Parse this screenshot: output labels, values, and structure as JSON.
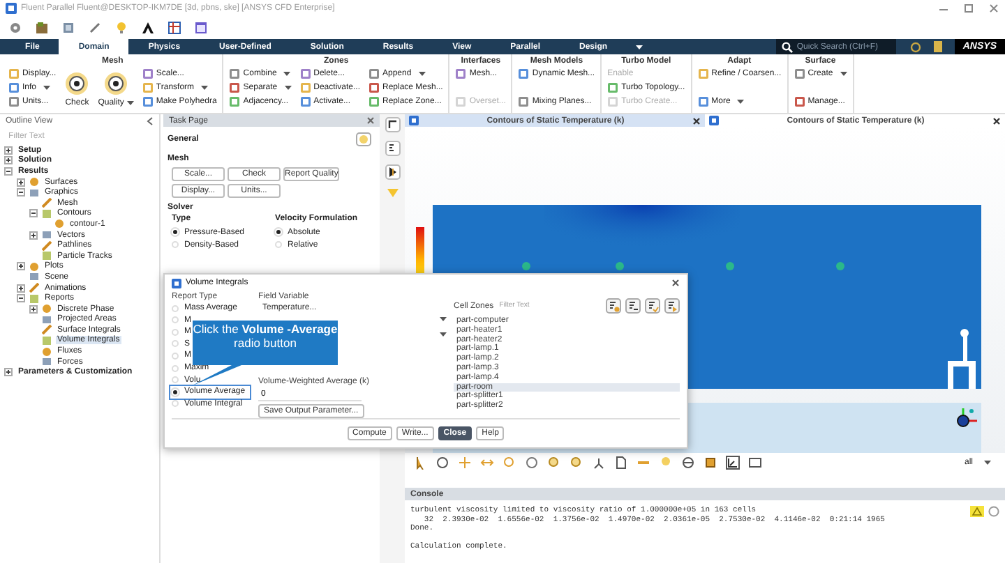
{
  "window": {
    "title": "Fluent Parallel Fluent@DESKTOP-IKM7DE [3d, pbns, ske] [ANSYS CFD Enterprise]"
  },
  "ribbon_tabs": [
    {
      "label": "File",
      "selected": false
    },
    {
      "label": "Domain",
      "selected": true
    },
    {
      "label": "Physics",
      "selected": false
    },
    {
      "label": "User-Defined",
      "selected": false
    },
    {
      "label": "Solution",
      "selected": false
    },
    {
      "label": "Results",
      "selected": false
    },
    {
      "label": "View",
      "selected": false
    },
    {
      "label": "Parallel",
      "selected": false
    },
    {
      "label": "Design",
      "selected": false
    }
  ],
  "search": {
    "placeholder": "Quick Search (Ctrl+F)"
  },
  "logo": "ANSYS",
  "ribbon_groups": [
    {
      "title": "Mesh",
      "columns": [
        [
          {
            "label": "Display...",
            "kind": "small",
            "dropdown": false,
            "disabled": false
          },
          {
            "label": "Info",
            "kind": "small",
            "dropdown": true,
            "disabled": false
          },
          {
            "label": "Units...",
            "kind": "small",
            "dropdown": false,
            "disabled": false
          }
        ],
        [
          {
            "label": "Check",
            "kind": "large",
            "dropdown": false,
            "disabled": false
          }
        ],
        [
          {
            "label": "Quality",
            "kind": "large",
            "dropdown": true,
            "disabled": false
          }
        ],
        [
          {
            "label": "Scale...",
            "kind": "small",
            "dropdown": false,
            "disabled": false
          },
          {
            "label": "Transform",
            "kind": "small",
            "dropdown": true,
            "disabled": false
          },
          {
            "label": "Make Polyhedra",
            "kind": "small",
            "dropdown": false,
            "disabled": false
          }
        ]
      ]
    },
    {
      "title": "Zones",
      "columns": [
        [
          {
            "label": "Combine",
            "kind": "small",
            "dropdown": true,
            "disabled": false
          },
          {
            "label": "Separate",
            "kind": "small",
            "dropdown": true,
            "disabled": false
          },
          {
            "label": "Adjacency...",
            "kind": "small",
            "dropdown": false,
            "disabled": false
          }
        ],
        [
          {
            "label": "Delete...",
            "kind": "small",
            "dropdown": false,
            "disabled": false
          },
          {
            "label": "Deactivate...",
            "kind": "small",
            "dropdown": false,
            "disabled": false
          },
          {
            "label": "Activate...",
            "kind": "small",
            "dropdown": false,
            "disabled": false
          }
        ],
        [
          {
            "label": "Append",
            "kind": "small",
            "dropdown": true,
            "disabled": false
          },
          {
            "label": "Replace Mesh...",
            "kind": "small",
            "dropdown": false,
            "disabled": false
          },
          {
            "label": "Replace Zone...",
            "kind": "small",
            "dropdown": false,
            "disabled": false
          }
        ]
      ]
    },
    {
      "title": "Interfaces",
      "columns": [
        [
          {
            "label": "Mesh...",
            "kind": "small",
            "dropdown": false,
            "disabled": false
          },
          {
            "label": "Overset...",
            "kind": "small",
            "dropdown": false,
            "disabled": true
          }
        ]
      ]
    },
    {
      "title": "Mesh Models",
      "columns": [
        [
          {
            "label": "Dynamic Mesh...",
            "kind": "small",
            "dropdown": false,
            "disabled": false
          },
          {
            "label": "Mixing Planes...",
            "kind": "small",
            "dropdown": false,
            "disabled": false
          }
        ]
      ]
    },
    {
      "title": "Turbo Model",
      "columns": [
        [
          {
            "label": "Enable",
            "kind": "plain",
            "dropdown": false,
            "disabled": true
          },
          {
            "label": "Turbo Topology...",
            "kind": "small",
            "dropdown": false,
            "disabled": false
          },
          {
            "label": "Turbo Create...",
            "kind": "small",
            "dropdown": false,
            "disabled": true
          }
        ]
      ]
    },
    {
      "title": "Adapt",
      "columns": [
        [
          {
            "label": "Refine / Coarsen...",
            "kind": "small",
            "dropdown": false,
            "disabled": false
          },
          {
            "label": "More",
            "kind": "small",
            "dropdown": true,
            "disabled": false
          }
        ]
      ]
    },
    {
      "title": "Surface",
      "columns": [
        [
          {
            "label": "Create",
            "kind": "small",
            "dropdown": true,
            "disabled": false
          },
          {
            "label": "Manage...",
            "kind": "small",
            "dropdown": false,
            "disabled": false
          }
        ]
      ]
    }
  ],
  "outline": {
    "title": "Outline View",
    "filter_placeholder": "Filter Text",
    "tree": [
      {
        "label": "Setup",
        "expanded": false,
        "selected": false
      },
      {
        "label": "Solution",
        "expanded": false,
        "selected": false
      },
      {
        "label": "Results",
        "expanded": true,
        "selected": false,
        "children": [
          {
            "label": "Surfaces",
            "expanded": false,
            "selected": false
          },
          {
            "label": "Graphics",
            "expanded": true,
            "selected": false,
            "children": [
              {
                "label": "Mesh",
                "selected": false
              },
              {
                "label": "Contours",
                "expanded": true,
                "selected": false,
                "children": [
                  {
                    "label": "contour-1",
                    "selected": false
                  }
                ]
              },
              {
                "label": "Vectors",
                "expanded": false,
                "selected": false
              },
              {
                "label": "Pathlines",
                "selected": false
              },
              {
                "label": "Particle Tracks",
                "selected": false
              }
            ]
          },
          {
            "label": "Plots",
            "expanded": false,
            "selected": false
          },
          {
            "label": "Scene",
            "selected": false
          },
          {
            "label": "Animations",
            "expanded": false,
            "selected": false
          },
          {
            "label": "Reports",
            "expanded": true,
            "selected": false,
            "children": [
              {
                "label": "Discrete Phase",
                "expanded": false,
                "selected": false
              },
              {
                "label": "Projected Areas",
                "selected": false
              },
              {
                "label": "Surface Integrals",
                "selected": false
              },
              {
                "label": "Volume Integrals",
                "selected": true
              },
              {
                "label": "Fluxes",
                "selected": false
              },
              {
                "label": "Forces",
                "selected": false
              }
            ]
          }
        ]
      },
      {
        "label": "Parameters & Customization",
        "expanded": false,
        "selected": false
      }
    ]
  },
  "task_page": {
    "title": "Task Page",
    "heading": "General",
    "mesh_label": "Mesh",
    "mesh_buttons": [
      [
        "Scale...",
        "Check",
        "Report Quality"
      ],
      [
        "Display...",
        "Units..."
      ]
    ],
    "solver_label": "Solver",
    "radio_groups": [
      {
        "label": "Type",
        "options": [
          {
            "label": "Pressure-Based",
            "selected": true
          },
          {
            "label": "Density-Based",
            "selected": false
          }
        ]
      },
      {
        "label": "Velocity Formulation",
        "options": [
          {
            "label": "Absolute",
            "selected": true
          },
          {
            "label": "Relative",
            "selected": false
          }
        ]
      }
    ]
  },
  "graphics": {
    "windows": [
      {
        "title": "Contours of Static Temperature (k)",
        "selected": true
      },
      {
        "title": "Contours of Static Temperature (k)",
        "selected": false
      }
    ],
    "view_filter": "all"
  },
  "console": {
    "title": "Console",
    "blocks": [
      [
        "turbulent viscosity limited to viscosity ratio of 1.000000e+05 in 163 cells",
        "   32  2.3930e-02  1.6556e-02  1.3756e-02  1.4970e-02  2.0361e-05  2.7530e-02  4.1146e-02  0:21:14 1965",
        "Done."
      ],
      [
        "Calculation complete."
      ]
    ]
  },
  "dialog": {
    "title": "Volume Integrals",
    "report_type_label": "Report Type",
    "report_types": [
      {
        "label": "Mass Average",
        "selected": false
      },
      {
        "label": "M",
        "selected": false
      },
      {
        "label": "M",
        "selected": false
      },
      {
        "label": "S",
        "selected": false
      },
      {
        "label": "M",
        "selected": false
      },
      {
        "label": "Maxim",
        "selected": false
      },
      {
        "label": "Volu",
        "selected": false
      },
      {
        "label": "Volume Average",
        "selected": true
      },
      {
        "label": "Volume Integral",
        "selected": false
      }
    ],
    "field_variable_label": "Field Variable",
    "field_variable": "Temperature...",
    "result_label": "Volume-Weighted Average (k)",
    "result_value": "0",
    "save_button": "Save Output Parameter...",
    "cell_zones_label": "Cell Zones",
    "cell_zones_filter_placeholder": "Filter Text",
    "cell_zones": [
      {
        "label": "part-computer",
        "selected": false
      },
      {
        "label": "part-heater1",
        "selected": false
      },
      {
        "label": "part-heater2",
        "selected": false
      },
      {
        "label": "part-lamp.1",
        "selected": false
      },
      {
        "label": "part-lamp.2",
        "selected": false
      },
      {
        "label": "part-lamp.3",
        "selected": false
      },
      {
        "label": "part-lamp.4",
        "selected": false
      },
      {
        "label": "part-room",
        "selected": true
      },
      {
        "label": "part-splitter1",
        "selected": false
      },
      {
        "label": "part-splitter2",
        "selected": false
      }
    ],
    "buttons": [
      {
        "label": "Compute",
        "kind": "normal"
      },
      {
        "label": "Write...",
        "kind": "normal"
      },
      {
        "label": "Close",
        "kind": "primary"
      },
      {
        "label": "Help",
        "kind": "normal"
      }
    ]
  },
  "callout": {
    "text": "Click the **Volume -Average** radio button"
  }
}
